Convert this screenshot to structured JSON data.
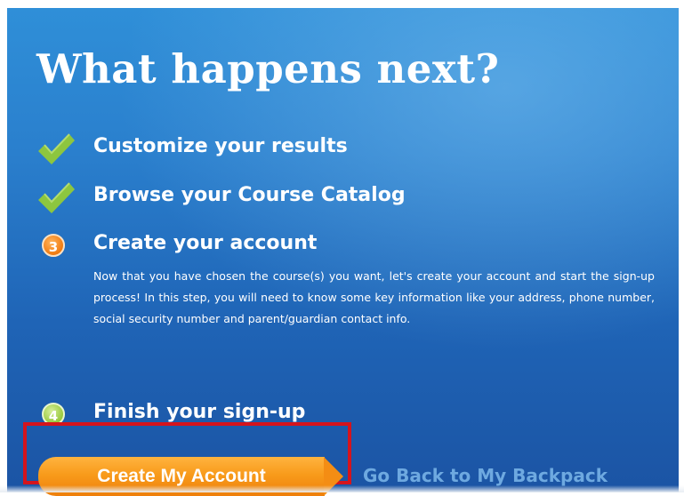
{
  "heading": "What happens next?",
  "steps": [
    {
      "icon": "checkmark-icon",
      "status": "done",
      "label": "Customize your results"
    },
    {
      "icon": "checkmark-icon",
      "status": "done",
      "label": "Browse your Course Catalog"
    },
    {
      "icon": "step-number-icon",
      "status": "current",
      "number": "3",
      "label": "Create your account"
    },
    {
      "icon": "step-number-icon",
      "status": "upcoming",
      "number": "4",
      "label": "Finish your sign-up"
    }
  ],
  "description": "Now that you have chosen the course(s) you want, let's create your account and start the sign-up process! In this step, you will need to know some key information like your address, phone number, social security number and parent/guardian contact info.",
  "actions": {
    "create_label": "Create My Account",
    "back_label": "Go Back to My Backpack"
  },
  "colors": {
    "panel_blue": "#2a7fcd",
    "check_green": "#8dc63f",
    "current_orange": "#f07a10",
    "upcoming_green": "#98c83c",
    "button_orange": "#f89b1b",
    "highlight_red": "#d4141d",
    "link_blue": "#6ea9e0"
  }
}
